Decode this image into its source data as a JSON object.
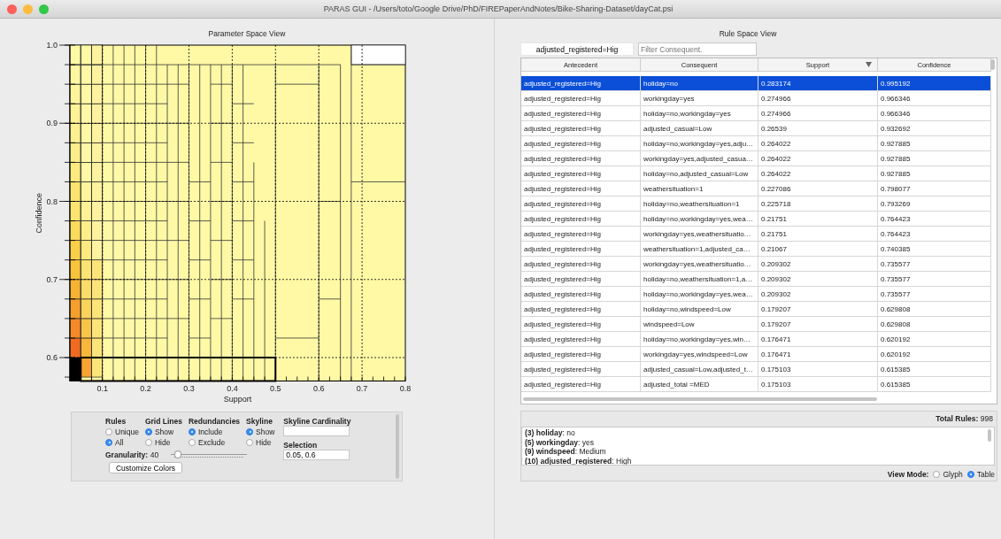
{
  "window": {
    "title": "PARAS GUI - /Users/toto/Google Drive/PhD/FIREPaperAndNotes/Bike-Sharing-Dataset/dayCat.psi"
  },
  "parameter_space": {
    "title": "Parameter Space View",
    "x_label": "Support",
    "y_label": "Confidence",
    "x_ticks": [
      "0.1",
      "0.2",
      "0.3",
      "0.4",
      "0.5",
      "0.6",
      "0.7",
      "0.8"
    ],
    "y_ticks": [
      "1.0",
      "0.9",
      "0.8",
      "0.7",
      "0.6"
    ]
  },
  "controls": {
    "groups": [
      {
        "title": "Rules",
        "options": [
          {
            "label": "Unique",
            "selected": false
          },
          {
            "label": "All",
            "selected": true
          }
        ]
      },
      {
        "title": "Grid Lines",
        "options": [
          {
            "label": "Show",
            "selected": true
          },
          {
            "label": "Hide",
            "selected": false
          }
        ]
      },
      {
        "title": "Redundancies",
        "options": [
          {
            "label": "Include",
            "selected": true
          },
          {
            "label": "Exclude",
            "selected": false
          }
        ]
      },
      {
        "title": "Skyline",
        "options": [
          {
            "label": "Show",
            "selected": true
          },
          {
            "label": "Hide",
            "selected": false
          }
        ]
      }
    ],
    "granularity": {
      "label": "Granularity:",
      "value": "40",
      "level": 0.05
    },
    "customize_button": "Customize Colors",
    "skyline_cardinality": {
      "label": "Skyline Cardinality"
    },
    "selection": {
      "label": "Selection",
      "value": "0.05, 0.6"
    }
  },
  "rule_space": {
    "title": "Rule Space View",
    "antecedent_filter": {
      "value": "adjusted_registered=Hig"
    },
    "consequent_filter": {
      "placeholder": "Filter Consequent."
    },
    "table": {
      "columns": [
        {
          "label": "Antecedent",
          "sorted": false
        },
        {
          "label": "Consequent",
          "sorted": false
        },
        {
          "label": "Support",
          "sorted": true
        },
        {
          "label": "Confidence",
          "sorted": false
        }
      ],
      "rows": [
        {
          "cells": [
            "adjusted_registered=Hig",
            "holiday=no",
            "0.283174",
            "0.995192"
          ],
          "selected": true
        },
        {
          "cells": [
            "adjusted_registered=Hig",
            "workingday=yes",
            "0.274966",
            "0.966346"
          ],
          "selected": false
        },
        {
          "cells": [
            "adjusted_registered=Hig",
            "holiday=no,workingday=yes",
            "0.274966",
            "0.966346"
          ],
          "selected": false
        },
        {
          "cells": [
            "adjusted_registered=Hig",
            "adjusted_casual=Low",
            "0.26539",
            "0.932692"
          ],
          "selected": false
        },
        {
          "cells": [
            "adjusted_registered=Hig",
            "holiday=no,workingday=yes,adju…",
            "0.264022",
            "0.927885"
          ],
          "selected": false
        },
        {
          "cells": [
            "adjusted_registered=Hig",
            "workingday=yes,adjusted_casua…",
            "0.264022",
            "0.927885"
          ],
          "selected": false
        },
        {
          "cells": [
            "adjusted_registered=Hig",
            "holiday=no,adjusted_casual=Low",
            "0.264022",
            "0.927885"
          ],
          "selected": false
        },
        {
          "cells": [
            "adjusted_registered=Hig",
            "weathersituation=1",
            "0.227086",
            "0.798077"
          ],
          "selected": false
        },
        {
          "cells": [
            "adjusted_registered=Hig",
            "holiday=no,weathersituation=1",
            "0.225718",
            "0.793269"
          ],
          "selected": false
        },
        {
          "cells": [
            "adjusted_registered=Hig",
            "holiday=no,workingday=yes,wea…",
            "0.21751",
            "0.764423"
          ],
          "selected": false
        },
        {
          "cells": [
            "adjusted_registered=Hig",
            "workingday=yes,weathersituatio…",
            "0.21751",
            "0.764423"
          ],
          "selected": false
        },
        {
          "cells": [
            "adjusted_registered=Hig",
            "weathersituation=1,adjusted_ca…",
            "0.21067",
            "0.740385"
          ],
          "selected": false
        },
        {
          "cells": [
            "adjusted_registered=Hig",
            "workingday=yes,weathersituatio…",
            "0.209302",
            "0.735577"
          ],
          "selected": false
        },
        {
          "cells": [
            "adjusted_registered=Hig",
            "holiday=no,weathersituation=1,a…",
            "0.209302",
            "0.735577"
          ],
          "selected": false
        },
        {
          "cells": [
            "adjusted_registered=Hig",
            "holiday=no,workingday=yes,wea…",
            "0.209302",
            "0.735577"
          ],
          "selected": false
        },
        {
          "cells": [
            "adjusted_registered=Hig",
            "holiday=no,windspeed=Low",
            "0.179207",
            "0.629808"
          ],
          "selected": false
        },
        {
          "cells": [
            "adjusted_registered=Hig",
            "windspeed=Low",
            "0.179207",
            "0.629808"
          ],
          "selected": false
        },
        {
          "cells": [
            "adjusted_registered=Hig",
            "holiday=no,workingday=yes,win…",
            "0.176471",
            "0.620192"
          ],
          "selected": false
        },
        {
          "cells": [
            "adjusted_registered=Hig",
            "workingday=yes,windspeed=Low",
            "0.176471",
            "0.620192"
          ],
          "selected": false
        },
        {
          "cells": [
            "adjusted_registered=Hig",
            "adjusted_casual=Low,adjusted_t…",
            "0.175103",
            "0.615385"
          ],
          "selected": false
        },
        {
          "cells": [
            "adjusted_registered=Hig",
            "adjusted_total =MED",
            "0.175103",
            "0.615385"
          ],
          "selected": false
        }
      ]
    },
    "total_rules": {
      "label": "Total Rules:",
      "value": "998"
    },
    "details": [
      "**(3) holiday**: no",
      "**(5) workingday**: yes",
      "**(9) windspeed**: Medium",
      "**(10) adjusted_registered**: High"
    ],
    "view_mode": {
      "label": "View Mode:",
      "options": [
        {
          "label": "Glyph",
          "selected": false
        },
        {
          "label": "Table",
          "selected": true
        }
      ]
    }
  }
}
